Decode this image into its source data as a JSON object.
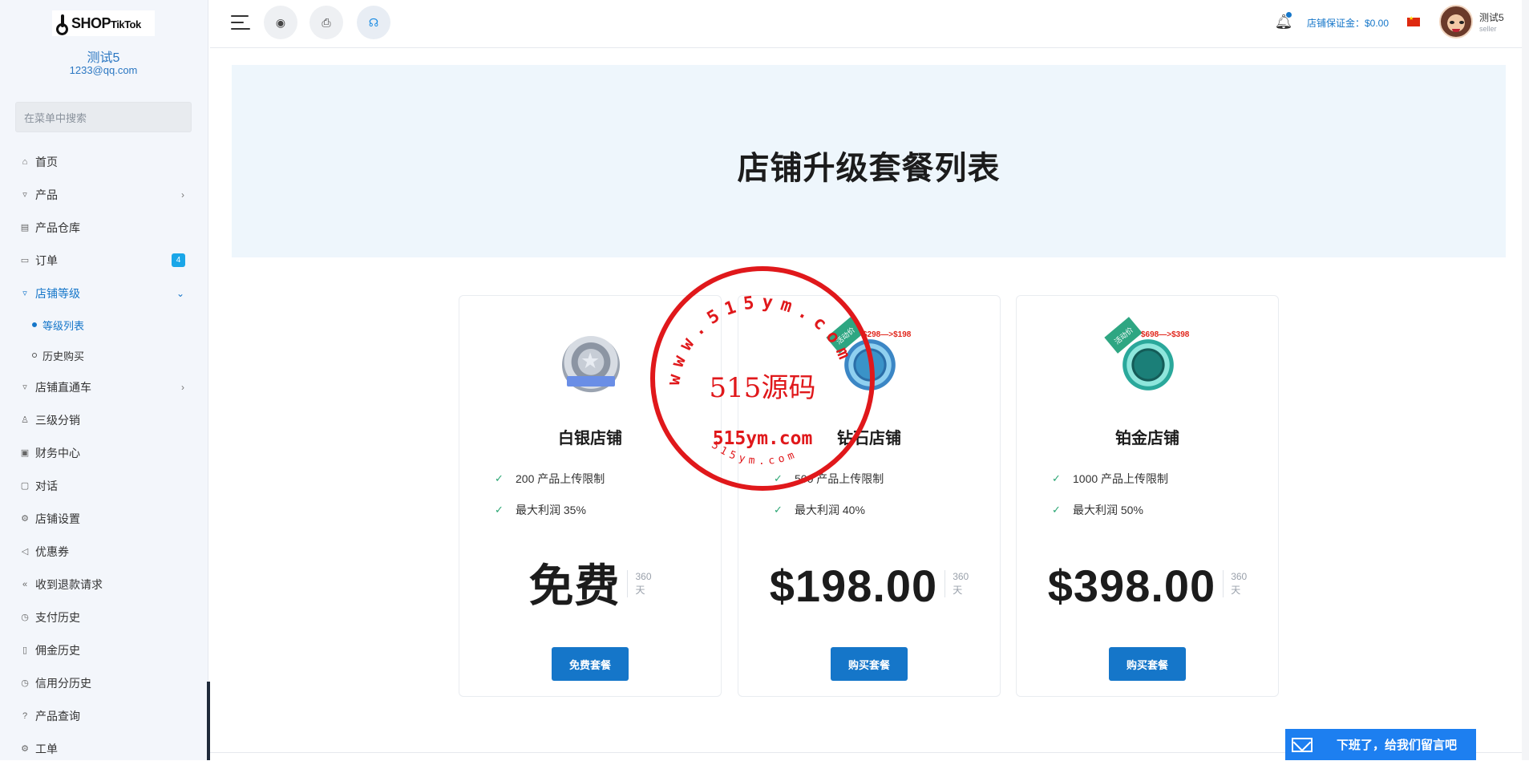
{
  "brand": {
    "logo_main": "SHOP",
    "logo_sub": "TikTok"
  },
  "profile": {
    "shop_name": "测试5",
    "email": "1233@qq.com"
  },
  "sidebar": {
    "search_placeholder": "在菜单中搜索",
    "items": [
      {
        "label": "首页",
        "icon": "home-icon"
      },
      {
        "label": "产品",
        "icon": "cart-icon",
        "has_children": true
      },
      {
        "label": "产品仓库",
        "icon": "warehouse-icon"
      },
      {
        "label": "订单",
        "icon": "order-icon",
        "badge": "4"
      },
      {
        "label": "店铺等级",
        "icon": "cart-icon",
        "expanded": true,
        "active": true
      },
      {
        "label": "等级列表",
        "sub": true,
        "active": true
      },
      {
        "label": "历史购买",
        "sub": true
      },
      {
        "label": "店铺直通车",
        "icon": "cart-icon",
        "has_children": true
      },
      {
        "label": "三级分销",
        "icon": "user-icon"
      },
      {
        "label": "财务中心",
        "icon": "wallet-icon"
      },
      {
        "label": "对话",
        "icon": "chat-icon"
      },
      {
        "label": "店铺设置",
        "icon": "gear-icon"
      },
      {
        "label": "优惠券",
        "icon": "megaphone-icon"
      },
      {
        "label": "收到退款请求",
        "icon": "refund-icon"
      },
      {
        "label": "支付历史",
        "icon": "history-icon"
      },
      {
        "label": "佣金历史",
        "icon": "document-icon"
      },
      {
        "label": "信用分历史",
        "icon": "history-icon"
      },
      {
        "label": "产品查询",
        "icon": "help-icon"
      },
      {
        "label": "工单",
        "icon": "gear-icon"
      }
    ]
  },
  "header": {
    "deposit_label": "店铺保证金：$0.00",
    "user_name": "测试5",
    "user_role": "seller"
  },
  "page": {
    "title": "店铺升级套餐列表"
  },
  "packages": [
    {
      "name": "白银店铺",
      "features": [
        "200 产品上传限制",
        "最大利润 35%"
      ],
      "price": "免费",
      "period_num": "360",
      "period_unit": "天",
      "button": "免费套餐",
      "emblem": "silver-emblem-icon"
    },
    {
      "name": "钻石店铺",
      "features": [
        "500 产品上传限制",
        "最大利润 40%"
      ],
      "price": "$198.00",
      "period_num": "360",
      "period_unit": "天",
      "button": "购买套餐",
      "emblem": "diamond-emblem-icon",
      "tag": "活动价",
      "promo": "$298—>$198"
    },
    {
      "name": "铂金店铺",
      "features": [
        "1000 产品上传限制",
        "最大利润 50%"
      ],
      "price": "$398.00",
      "period_num": "360",
      "period_unit": "天",
      "button": "购买套餐",
      "emblem": "platinum-emblem-icon",
      "tag": "活动价",
      "promo": "$698—>$398"
    }
  ],
  "watermark": {
    "line1": "515源码",
    "line2": "515ym.com",
    "ring_top": "www.515ym.com",
    "ring_bottom": "515ym.com"
  },
  "widget": {
    "message": "下班了，给我们留言吧"
  },
  "colors": {
    "primary": "#1576c9",
    "hero_bg": "#eef6fc",
    "check": "#2aa673",
    "stamp": "#e0181b",
    "badge": "#1aa6e8"
  }
}
